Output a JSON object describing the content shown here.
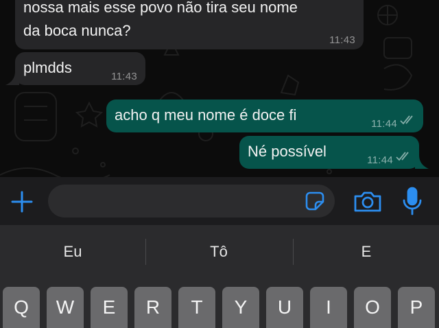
{
  "messages": [
    {
      "direction": "incoming",
      "line1": "nossa mais esse povo não tira seu nome",
      "line2": "da boca nunca?",
      "time": "11:43"
    },
    {
      "direction": "incoming",
      "text": "plmdds",
      "time": "11:43"
    },
    {
      "direction": "outgoing",
      "text": "acho q meu nome é doce fi",
      "time": "11:44",
      "status": "read"
    },
    {
      "direction": "outgoing",
      "text": "Né possível",
      "time": "11:44",
      "status": "read"
    }
  ],
  "compose": {
    "placeholder": "",
    "icons": [
      "plus-icon",
      "sticker-icon",
      "camera-icon",
      "microphone-icon"
    ]
  },
  "keyboard": {
    "suggestions": [
      "Eu",
      "Tô",
      "E"
    ],
    "row1": [
      "Q",
      "W",
      "E",
      "R",
      "T",
      "Y",
      "U",
      "I",
      "O",
      "P"
    ]
  },
  "colors": {
    "accent": "#2c8ef0",
    "outgoing_bubble": "#06544b",
    "incoming_bubble": "#262628"
  }
}
